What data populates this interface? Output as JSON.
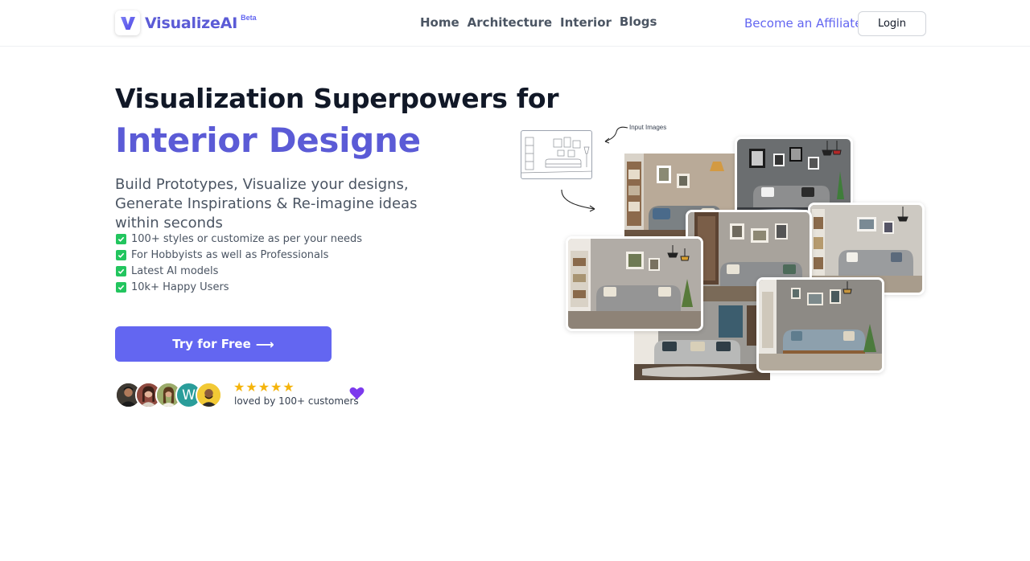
{
  "brand": {
    "name": "VisualizeAI",
    "badge": "Beta",
    "logo_icon": "v-logo-icon",
    "accent": "#6366f1"
  },
  "nav": {
    "items": [
      "Home",
      "Architecture",
      "Interior",
      "Blogs"
    ]
  },
  "header": {
    "affiliate_label": "Become an Affiliate",
    "login_label": "Login"
  },
  "hero": {
    "title_line1": "Visualization Superpowers for",
    "title_line2": "Interior Designe",
    "subtitle": "Build Prototypes, Visualize your designs, Generate Inspirations & Re-imagine ideas within seconds",
    "features": [
      "100+ styles or customize as per your needs",
      "For Hobbyists as well as Professionals",
      "Latest AI models",
      "10k+ Happy Users"
    ],
    "cta_label": "Try for Free",
    "cta_icon": "arrow-right-icon"
  },
  "social_proof": {
    "rating_stars": 5,
    "loved_text": "loved by 100+ customers",
    "avatar_letter": "W",
    "heart_icon": "heart-icon"
  },
  "collage": {
    "annotation": "Input Images"
  },
  "colors": {
    "primary": "#6366f1",
    "brand_text": "#5b5bd6",
    "check": "#22c55e",
    "star": "#f5b40b",
    "heart": "#7c3aed"
  }
}
